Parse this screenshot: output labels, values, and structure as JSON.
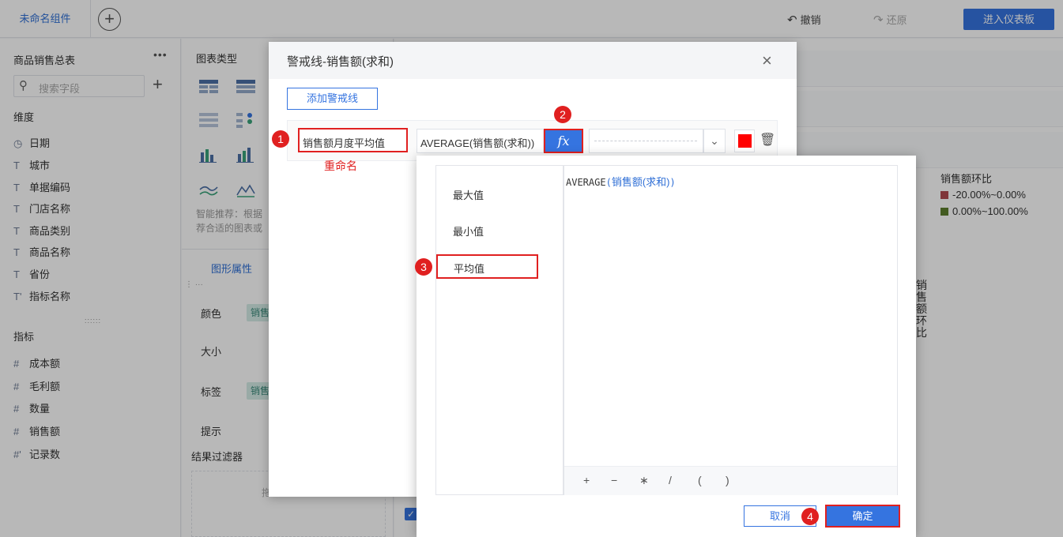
{
  "topbar": {
    "component_name": "未命名组件",
    "add_icon": "plus-circle-icon",
    "undo_label": "撤销",
    "redo_label": "还原",
    "enter_dashboard_label": "进入仪表板"
  },
  "left_panel": {
    "title": "商品销售总表",
    "more_icon": "ellipsis-icon",
    "search_placeholder": "搜索字段",
    "dimension_title": "维度",
    "dimensions": [
      {
        "type_icon": "◷",
        "label": "日期"
      },
      {
        "type_icon": "T",
        "label": "城市"
      },
      {
        "type_icon": "T",
        "label": "单据编码"
      },
      {
        "type_icon": "T",
        "label": "门店名称"
      },
      {
        "type_icon": "T",
        "label": "商品类别"
      },
      {
        "type_icon": "T",
        "label": "商品名称"
      },
      {
        "type_icon": "T",
        "label": "省份"
      },
      {
        "type_icon": "T'",
        "label": "指标名称"
      }
    ],
    "measure_title": "指标",
    "measures": [
      {
        "type_icon": "#",
        "label": "成本额"
      },
      {
        "type_icon": "#",
        "label": "毛利额"
      },
      {
        "type_icon": "#",
        "label": "数量"
      },
      {
        "type_icon": "#",
        "label": "销售额"
      },
      {
        "type_icon": "#'",
        "label": "记录数"
      }
    ]
  },
  "mid_panel": {
    "chart_type_title": "图表类型",
    "recommend_text_1": "智能推荐：根据",
    "recommend_text_2": "荐合适的图表或",
    "tab_shape": "图形属性",
    "props": [
      {
        "label": "颜色",
        "chip": "销售"
      },
      {
        "label": "大小",
        "chip": ""
      },
      {
        "label": "标签",
        "chip": "销售"
      },
      {
        "label": "提示",
        "chip": ""
      }
    ],
    "filter_title": "结果过滤器",
    "filter_hint": "拖"
  },
  "canvas": {
    "legend_title": "销售额环比",
    "legend": [
      {
        "label": "-20.00%~0.00%",
        "color": "#b04a50"
      },
      {
        "label": "0.00%~100.00%",
        "color": "#5d7e2f"
      }
    ],
    "vertical_label": "销售额环比"
  },
  "dialog_warning": {
    "title": "警戒线-销售额(求和)",
    "add_button": "添加警戒线",
    "line_name": "销售额月度平均值",
    "formula": "AVERAGE(销售额(求和))",
    "fx_label": "fx",
    "line_color": "#ff0000",
    "rename_note": "重命名"
  },
  "dialog_formula": {
    "functions": [
      "最大值",
      "最小值",
      "平均值"
    ],
    "code_func": "AVERAGE",
    "code_open": "(",
    "code_field": "销售额(求和)",
    "code_close": ")",
    "operators": [
      "+",
      "−",
      "∗",
      "/",
      "(",
      ")"
    ],
    "cancel_label": "取消",
    "ok_label": "确定"
  },
  "steps": [
    "1",
    "2",
    "3",
    "4"
  ]
}
